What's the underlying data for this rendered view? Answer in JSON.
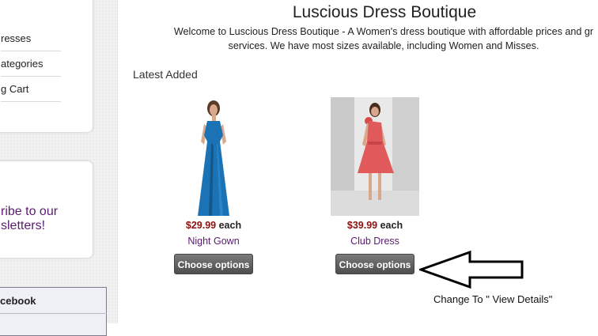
{
  "sidebar": {
    "nav_items": [
      "resses",
      "ategories",
      "g Cart"
    ],
    "subscribe_lines": [
      "ribe to our",
      "sletters!"
    ],
    "facebook_title": "cebook"
  },
  "header": {
    "title": "Luscious Dress Boutique",
    "welcome_line1": "Welcome to Luscious Dress Boutique - A Women's dress boutique with affordable prices and gr",
    "welcome_line2": "services. We have most sizes available, including Women and Misses."
  },
  "section": {
    "title": "Latest Added"
  },
  "products": [
    {
      "price": "$29.99",
      "each": "each",
      "name": "Night Gown",
      "button": "Choose options",
      "dress_color": "#1b72b4"
    },
    {
      "price": "$39.99",
      "each": "each",
      "name": "Club Dress",
      "button": "Choose options",
      "dress_color": "#e05a5c"
    }
  ],
  "annotation": {
    "text": "Change To \" View Details\""
  },
  "colors": {
    "price": "#8b1010",
    "link": "#5b1a72",
    "button": "#5a5a5a"
  }
}
